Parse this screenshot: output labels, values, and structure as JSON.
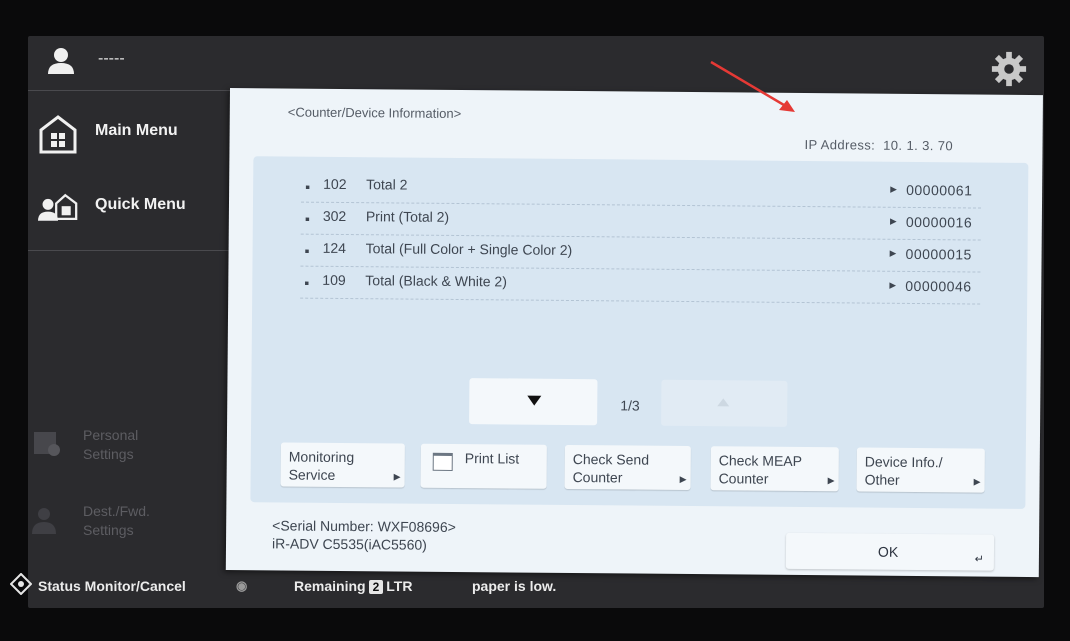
{
  "header": {
    "user_name": "-----"
  },
  "nav": {
    "main_menu": "Main Menu",
    "quick_menu": "Quick Menu",
    "personal_settings": [
      "Personal",
      "Settings"
    ],
    "dest_fwd_settings": [
      "Dest./Fwd.",
      "Settings"
    ]
  },
  "panel": {
    "title": "<Counter/Device Information>",
    "ip_address_label": "IP Address:",
    "ip_address": "10. 1. 3. 70",
    "counters": [
      {
        "code": "102",
        "name": "Total 2",
        "value": "00000061"
      },
      {
        "code": "302",
        "name": "Print (Total 2)",
        "value": "00000016"
      },
      {
        "code": "124",
        "name": "Total (Full Color + Single Color 2)",
        "value": "00000015"
      },
      {
        "code": "109",
        "name": "Total (Black & White 2)",
        "value": "00000046"
      }
    ],
    "page_indicator": "1/3",
    "buttons": [
      {
        "line1": "Monitoring",
        "line2": "Service"
      },
      {
        "line1": "Print List",
        "line2": ""
      },
      {
        "line1": "Check Send",
        "line2": "Counter"
      },
      {
        "line1": "Check MEAP",
        "line2": "Counter"
      },
      {
        "line1": "Device Info./",
        "line2": "Other"
      }
    ],
    "serial_line1": "<Serial Number: WXF08696>",
    "serial_line2": "iR-ADV C5535(iAC5560)",
    "ok_label": "OK"
  },
  "status_bar": {
    "monitor_label": "Status Monitor/Cancel",
    "remaining_label": "Remaining",
    "remaining_count": "2",
    "paper_size": "LTR",
    "message": "paper is low."
  },
  "colors": {
    "screen_bg": "#2b2b2e",
    "panel_bg": "#eef4f9",
    "inner_bg": "#d8e6f2",
    "annotation_arrow": "#e53935"
  },
  "icons": [
    "user-icon",
    "gear-icon",
    "home-icon",
    "quick-menu-icon",
    "printer-icon",
    "status-monitor-icon",
    "toner-icon"
  ]
}
